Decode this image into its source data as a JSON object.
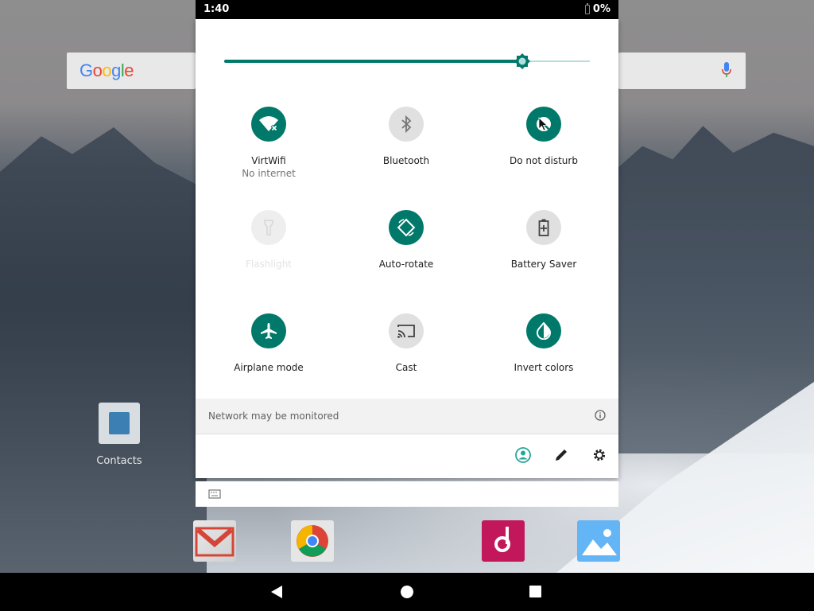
{
  "status_bar": {
    "time": "1:40",
    "battery": "0%"
  },
  "home": {
    "search_logo": "Google",
    "contacts_label": "Contacts",
    "dock_apps": [
      "gmail-icon",
      "chrome-icon",
      "music-icon",
      "photos-icon"
    ]
  },
  "brightness": {
    "level_fraction": 0.815
  },
  "tiles": [
    {
      "label": "VirtWifi",
      "sublabel": "No internet",
      "state": "on",
      "icon": "wifi-no-internet-icon"
    },
    {
      "label": "Bluetooth",
      "sublabel": "",
      "state": "off",
      "icon": "bluetooth-icon"
    },
    {
      "label": "Do not disturb",
      "sublabel": "",
      "state": "on",
      "icon": "do-not-disturb-icon"
    },
    {
      "label": "Flashlight",
      "sublabel": "",
      "state": "unavailable",
      "icon": "flashlight-icon"
    },
    {
      "label": "Auto-rotate",
      "sublabel": "",
      "state": "on",
      "icon": "auto-rotate-icon"
    },
    {
      "label": "Battery Saver",
      "sublabel": "",
      "state": "off",
      "icon": "battery-saver-icon"
    },
    {
      "label": "Airplane mode",
      "sublabel": "",
      "state": "on",
      "icon": "airplane-icon"
    },
    {
      "label": "Cast",
      "sublabel": "",
      "state": "off",
      "icon": "cast-icon"
    },
    {
      "label": "Invert colors",
      "sublabel": "",
      "state": "on",
      "icon": "invert-colors-icon"
    }
  ],
  "network_notice": "Network may be monitored",
  "footer": [
    "user-icon",
    "edit-icon",
    "settings-icon"
  ],
  "colors": {
    "accent": "#00796b",
    "tile_off": "#e0e0e0",
    "user_icon": "#26a69a"
  }
}
